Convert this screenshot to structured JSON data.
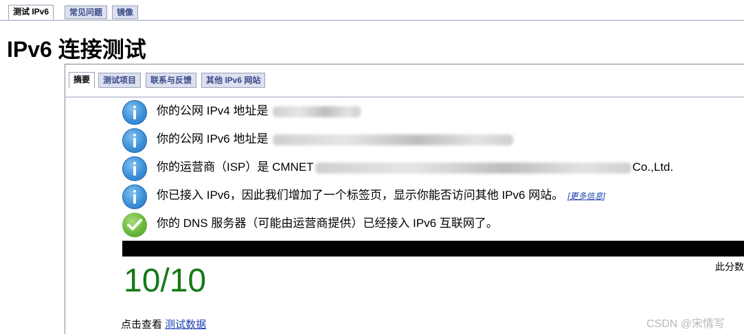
{
  "top_tabs": [
    {
      "label": "测试 IPv6",
      "active": true
    },
    {
      "label": "常见问题",
      "active": false
    },
    {
      "label": "镜像",
      "active": false
    }
  ],
  "page_title": "IPv6 连接测试",
  "sub_tabs": [
    {
      "label": "摘要",
      "active": true
    },
    {
      "label": "测试项目",
      "active": false
    },
    {
      "label": "联系与反馈",
      "active": false
    },
    {
      "label": "其他 IPv6 网站",
      "active": false
    }
  ],
  "results": [
    {
      "icon": "info-icon",
      "prefix": "你的公网 IPv4 地址是 ",
      "visible_value": "",
      "suffix": ""
    },
    {
      "icon": "info-icon",
      "prefix": "你的公网 IPv6 地址是 ",
      "visible_value": "",
      "suffix": ""
    },
    {
      "icon": "info-icon",
      "prefix": "你的运营商（ISP）是 CMNET",
      "visible_value": "",
      "suffix": "Co.,Ltd."
    },
    {
      "icon": "info-icon",
      "prefix": "你已接入 IPv6，因此我们增加了一个标签页，显示你能否访问其他 IPv6 网站。",
      "link": "[更多信息]"
    },
    {
      "icon": "check-icon",
      "prefix": "你的 DNS 服务器（可能由运营商提供）已经接入 IPv6 互联网了。"
    }
  ],
  "score": "10/10",
  "score_note": "此分数",
  "footer": {
    "prefix": "点击查看 ",
    "link": "测试数据"
  },
  "watermark": "CSDN @宋情写",
  "colors": {
    "score": "#147a14",
    "link": "#1a3fb0",
    "tab_bg": "#dde0ef"
  }
}
